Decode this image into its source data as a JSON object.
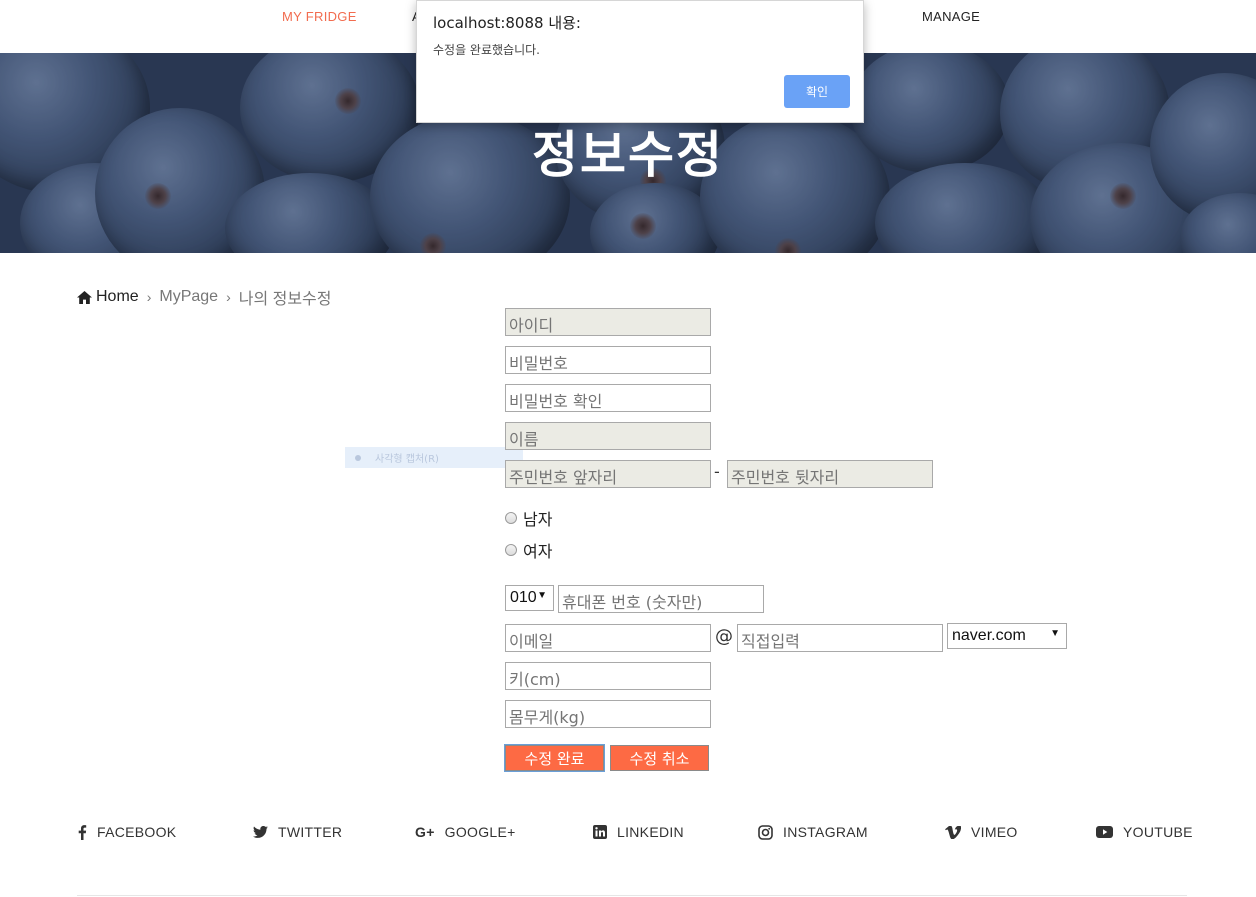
{
  "nav": {
    "items": [
      {
        "label": "MY FRIDGE",
        "active": true
      },
      {
        "label": "A",
        "active": false
      },
      {
        "label": "MANAGE",
        "active": false
      }
    ]
  },
  "hero": {
    "title": "정보수정"
  },
  "breadcrumb": {
    "home": "Home",
    "items": [
      "MyPage",
      "나의 정보수정"
    ]
  },
  "ghost_hint": {
    "label": "사각형 캡처(R)"
  },
  "form": {
    "id_placeholder": "아이디",
    "password_placeholder": "비밀번호",
    "password_confirm_placeholder": "비밀번호 확인",
    "name_placeholder": "이름",
    "ssn_front_placeholder": "주민번호 앞자리",
    "ssn_separator": "-",
    "ssn_back_placeholder": "주민번호 뒷자리",
    "gender_options": [
      "남자",
      "여자"
    ],
    "phone_prefix": "010",
    "phone_placeholder": "휴대폰 번호 (숫자만)",
    "email_placeholder": "이메일",
    "email_at": "@",
    "email_domain_placeholder": "직접입력",
    "email_domain_select": "naver.com",
    "height_placeholder": "키(cm)",
    "weight_placeholder": "몸무게(kg)",
    "submit_label": "수정 완료",
    "cancel_label": "수정 취소"
  },
  "social": [
    {
      "label": "FACEBOOK",
      "icon": "facebook-icon"
    },
    {
      "label": "TWITTER",
      "icon": "twitter-icon"
    },
    {
      "label": "GOOGLE+",
      "icon": "google-plus-icon"
    },
    {
      "label": "LINKEDIN",
      "icon": "linkedin-icon"
    },
    {
      "label": "INSTAGRAM",
      "icon": "instagram-icon"
    },
    {
      "label": "VIMEO",
      "icon": "vimeo-icon"
    },
    {
      "label": "YOUTUBE",
      "icon": "youtube-icon"
    }
  ],
  "dialog": {
    "title": "localhost:8088 내용:",
    "message": "수정을 완료했습니다.",
    "ok_label": "확인"
  },
  "colors": {
    "accent": "#f26c4f",
    "button": "#fd6a44",
    "dialog_button": "#6aa2f6"
  }
}
